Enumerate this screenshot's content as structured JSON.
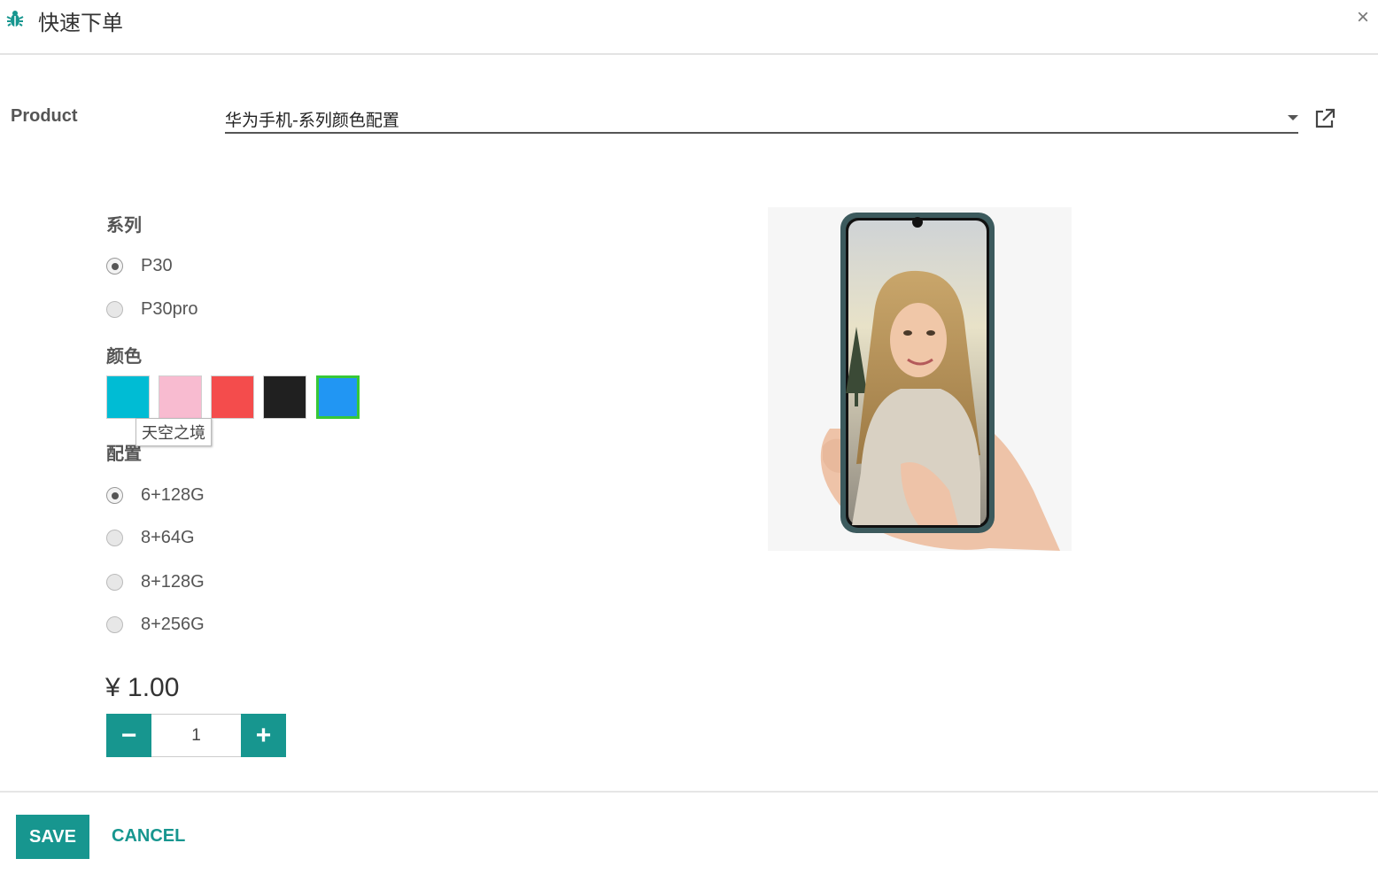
{
  "header": {
    "title": "快速下单",
    "close_label": "×",
    "icon": "bug-icon"
  },
  "product": {
    "label": "Product",
    "value": "华为手机-系列颜色配置"
  },
  "series": {
    "label": "系列",
    "options": [
      {
        "label": "P30",
        "checked": true
      },
      {
        "label": "P30pro",
        "checked": false
      }
    ]
  },
  "color": {
    "label": "颜色",
    "swatches": [
      "#00bcd4",
      "#f8bbd0",
      "#f44c4c",
      "#202020",
      "#2196f3"
    ],
    "selected_index": 4,
    "tooltip": "天空之境"
  },
  "config": {
    "label": "配置",
    "options": [
      {
        "label": "6+128G",
        "checked": true
      },
      {
        "label": "8+64G",
        "checked": false
      },
      {
        "label": "8+128G",
        "checked": false
      },
      {
        "label": "8+256G",
        "checked": false
      }
    ]
  },
  "price": "¥ 1.00",
  "quantity": {
    "minus": "−",
    "value": "1",
    "plus": "+"
  },
  "footer": {
    "save_label": "SAVE",
    "cancel_label": "CANCEL"
  },
  "colors": {
    "accent": "#17968f",
    "selected_border": "#37c837"
  }
}
